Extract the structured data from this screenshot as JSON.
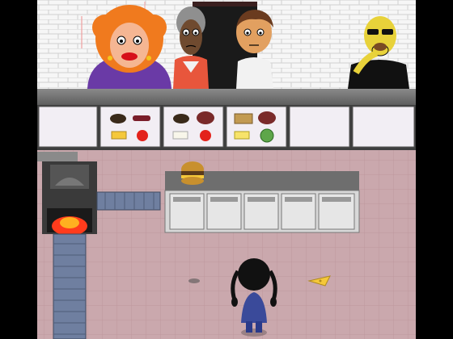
{
  "game": {
    "customers": [
      {
        "name": "customer-red-hair-woman",
        "hair": "#f07a1e",
        "skin": "#f5b693",
        "shirt": "#6a3aa6"
      },
      {
        "name": "customer-grey-hair-old-woman",
        "hair": "#8f8f8f",
        "skin": "#6f4a2f",
        "shirt": "#e8563c"
      },
      {
        "name": "customer-brown-hair-man",
        "hair": "#6a3b1f",
        "skin": "#e2a060",
        "shirt": "#f2f2f2"
      },
      {
        "name": "customer-bald-man-sunglasses",
        "hair": "none",
        "skin": "#e8d23a",
        "shirt": "#111111"
      }
    ],
    "order_trays": [
      {
        "items": [
          "bun-bottom-icon",
          "sausage-icon",
          "cheese-icon",
          "tomato-icon"
        ]
      },
      {
        "items": [
          "bun-bottom-icon",
          "ham-icon",
          "onion-icon",
          "tomato-icon"
        ]
      },
      {
        "items": [
          "bread-icon",
          "ham-icon",
          "swiss-cheese-icon",
          "melon-icon"
        ]
      },
      {
        "items": []
      },
      {
        "items": []
      }
    ],
    "counter_item": "burger-icon",
    "floor_item": "cheese-slice-icon",
    "player": "girl-with-pigtails",
    "colors": {
      "wall": "#f4f4f4",
      "counter": "#6e6e6e",
      "floor": "#caa8ad",
      "oven": "#3a3a3a",
      "fire": "#ff3b1c",
      "conveyor": "#6f7fa0"
    }
  }
}
